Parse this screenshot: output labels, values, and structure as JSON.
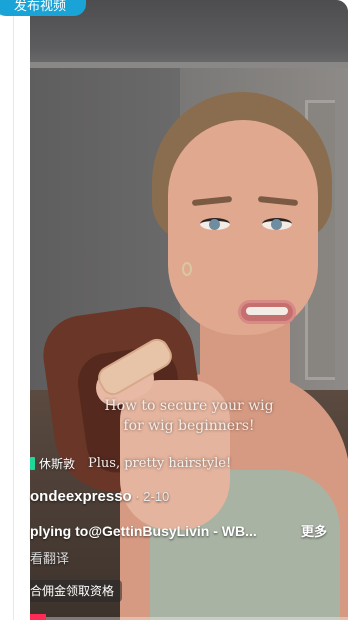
{
  "publish_button": {
    "label": "发布视频"
  },
  "video": {
    "caption_lines": [
      "How to secure your wig",
      "for wig beginners!"
    ],
    "caption_line_3": "Plus, pretty hairstyle!",
    "location": "休斯敦",
    "author": "ondeexpresso",
    "date": " · 2-10",
    "reply_text": "plying to@GettinBusyLivin - WB...",
    "more_label": "更多",
    "translate_label": "看翻译",
    "commission_label": "合佣金领取资格"
  },
  "colors": {
    "publish_bg": "#1aa3d6",
    "location_pin": "#20d89a",
    "progress_accent": "#fe2c55"
  }
}
